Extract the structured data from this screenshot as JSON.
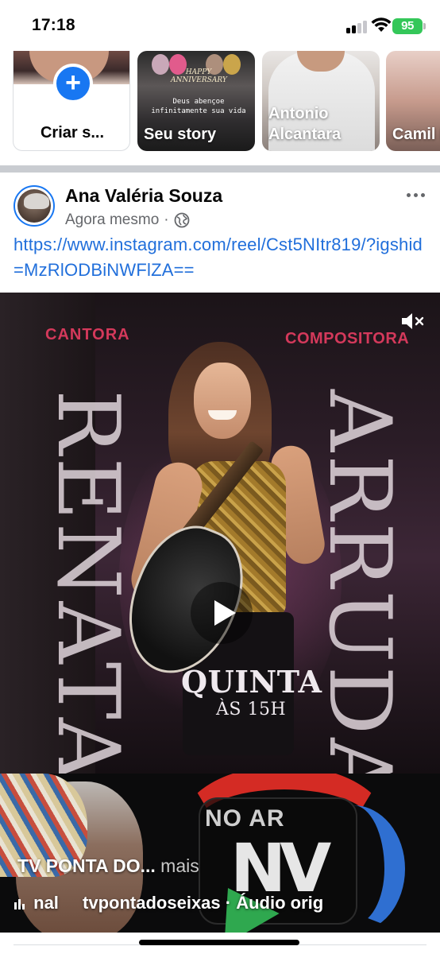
{
  "status_bar": {
    "time": "17:18",
    "battery": "95",
    "battery_color": "#34c759",
    "icons": [
      "signal-icon",
      "wifi-icon",
      "battery-icon"
    ]
  },
  "stories": {
    "create": {
      "label": "Criar s...",
      "icon": "plus-icon",
      "accent": "#1877f2"
    },
    "items": [
      {
        "label": "Seu story",
        "card_text_1": "HAPPY ANNIVERSARY",
        "card_text_2": "Deus abençoe infinitamente sua vida"
      },
      {
        "label": "Antonio Alcantara"
      },
      {
        "label": "Camil Buriti"
      }
    ]
  },
  "post": {
    "author": "Ana Valéria Souza",
    "time": "Agora mesmo",
    "separator": "·",
    "privacy_icon": "globe-icon",
    "more_icon": "more-dots-icon",
    "link": "https://www.instagram.com/reel/Cst5NItr819/?igshid=MzRlODBiNWFlZA==",
    "link_color": "#216fdb"
  },
  "reel": {
    "left_tag": "CANTORA",
    "right_tag": "COMPOSITORA",
    "tag_color": "#d4395b",
    "vertical_left": "RENATA",
    "vertical_right": "ARRUDA",
    "day": "QUINTA",
    "time": "ÀS 15H",
    "mute_icon": "speaker-muted-icon",
    "play_icon": "play-icon"
  },
  "reel_footer": {
    "logo_top": "NO AR",
    "logo_mark": "NV",
    "caption": "TV PONTA DO...",
    "more": "mais",
    "audio_prefix": "nal",
    "audio_account": "tvpontadoseixas",
    "audio_separator": "·",
    "audio_label": "Áudio orig"
  }
}
